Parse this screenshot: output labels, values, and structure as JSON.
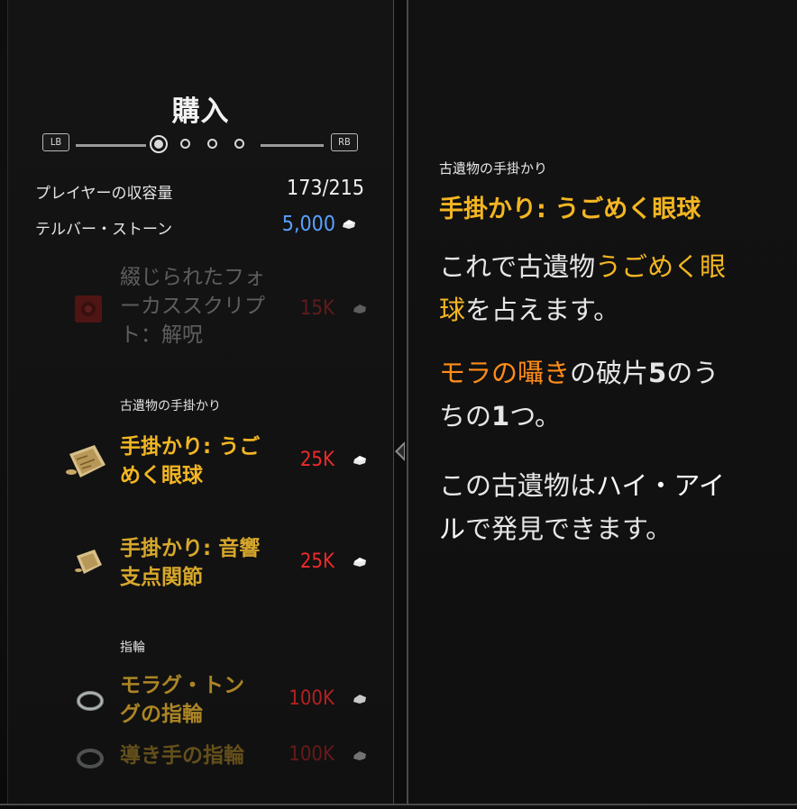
{
  "window": {
    "title": "購入",
    "lb_label": "LB",
    "rb_label": "RB"
  },
  "pagination": {
    "pages": 4,
    "current": 1
  },
  "stats": {
    "capacity_label": "プレイヤーの収容量",
    "capacity_value": "173/215",
    "currency_label": "テルバー・ストーン",
    "currency_value": "5,000"
  },
  "items": [
    {
      "name_line1": "綴じられたフォ",
      "name_line2": "ーカススクリプ",
      "name_line3": "ト：解呪",
      "price": "15K",
      "state": "disabled"
    },
    {
      "category": "古遺物の手掛かり"
    },
    {
      "name_line1": "手掛かり: うご",
      "name_line2": "めく眼球",
      "price": "25K",
      "state": "selected"
    },
    {
      "name_line1": "手掛かり: 音響",
      "name_line2": "支点関節",
      "price": "25K",
      "state": "normal"
    },
    {
      "category": "指輪"
    },
    {
      "name_line1": "モラグ・トン",
      "name_line2": "グの指輪",
      "price": "100K",
      "state": "normal"
    },
    {
      "name_line1": "導き手の指輪",
      "price": "100K",
      "state": "faded"
    }
  ],
  "detail": {
    "category": "古遺物の手掛かり",
    "title": "手掛かり: うごめく眼球",
    "p1_a": "これで古遺物",
    "p1_b": "うごめく眼",
    "p1_c": "球",
    "p1_d": "を占えます。",
    "p2_a": "モラの囁き",
    "p2_b": "の破片",
    "p2_c": "5",
    "p2_d": "のう",
    "p2_e": "ちの",
    "p2_f": "1",
    "p2_g": "つ。",
    "p3_a": "この古遺物は",
    "p3_b": "ハイ・アイ",
    "p3_c": "ル",
    "p3_d": "で発見できます。"
  },
  "colors": {
    "gold": "#f3b622",
    "orange": "#ff8c1a",
    "price_red": "#ee2a2a",
    "currency_blue": "#5aa0ff",
    "text": "#e6e6e6"
  },
  "icons": {
    "item0": "red-book-icon",
    "item2": "scroll-map-icon",
    "item3": "scroll-map-icon",
    "item5": "ring-icon",
    "item6": "ring-icon",
    "currency": "telvar-stone-icon"
  }
}
